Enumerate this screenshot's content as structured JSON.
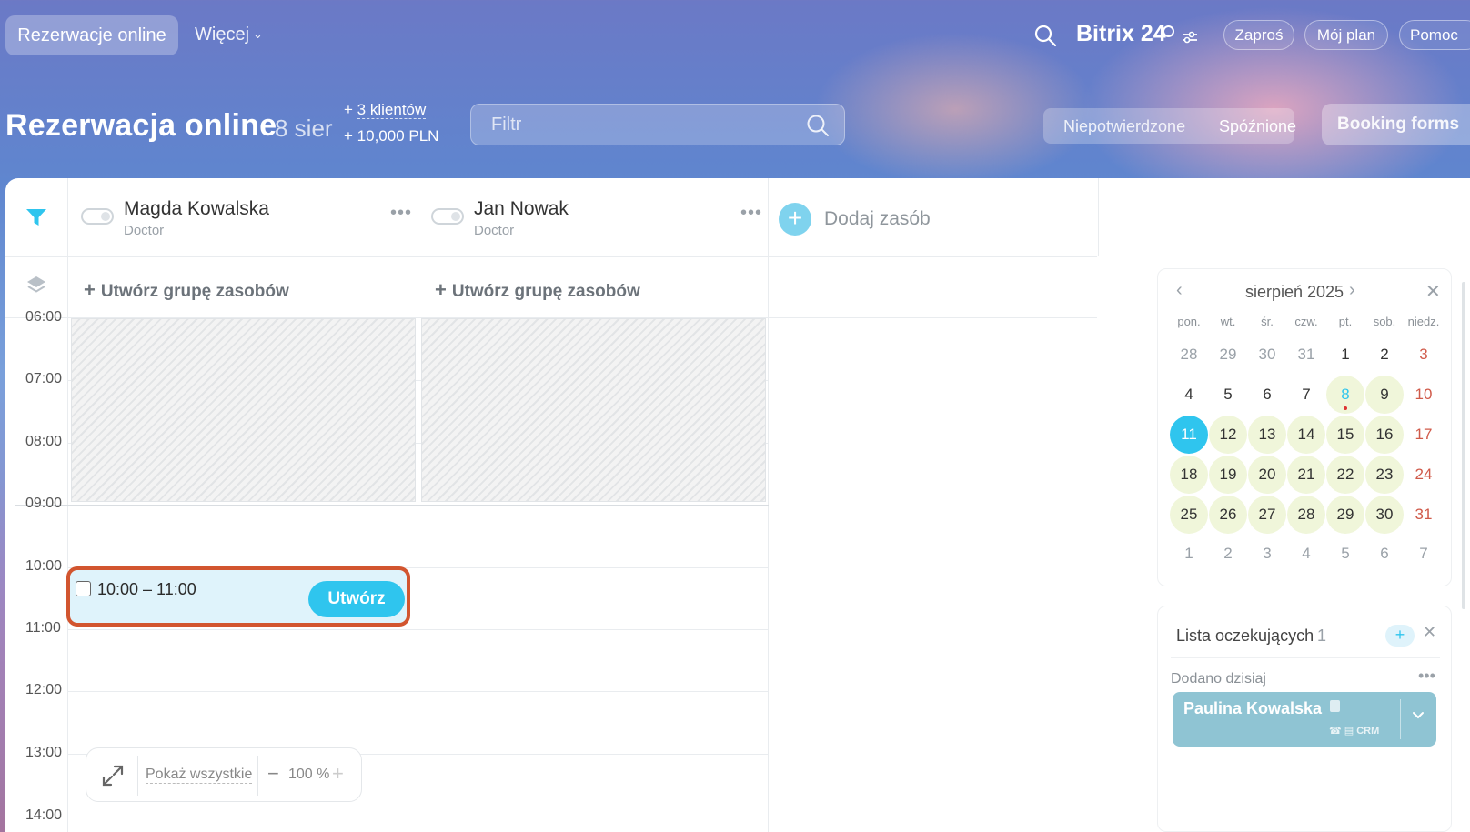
{
  "topbar": {
    "main_tab": "Rezerwacje online",
    "more": "Więcej",
    "logo": "Bitrix 24",
    "invite": "Zaproś",
    "my_plan": "Mój plan",
    "help": "Pomoc"
  },
  "header": {
    "title": "Rezerwacja online",
    "date": "8 sier",
    "stat_clients": "3 klientów",
    "stat_amount": "10,000 PLN",
    "stat_prefix": "+",
    "filter_placeholder": "Filtr",
    "unconfirmed": "Niepotwierdzone",
    "late": "Spóźnione",
    "booking_forms": "Booking forms"
  },
  "resources": [
    {
      "name": "Magda Kowalska",
      "role": "Doctor"
    },
    {
      "name": "Jan Nowak",
      "role": "Doctor"
    }
  ],
  "add_resource": "Dodaj zasób",
  "create_group": "Utwórz grupę zasobów",
  "timeline": {
    "hours": [
      "06:00",
      "07:00",
      "08:00",
      "09:00",
      "10:00",
      "11:00",
      "12:00",
      "13:00",
      "14:00"
    ]
  },
  "booking": {
    "time": "10:00 – 11:00",
    "create": "Utwórz"
  },
  "zoom": {
    "show_all": "Pokaż wszystkie",
    "minus": "−",
    "value": "100 %",
    "plus": "+"
  },
  "calendar": {
    "title": "sierpień 2025",
    "weekdays": [
      "pon.",
      "wt.",
      "śr.",
      "czw.",
      "pt.",
      "sob.",
      "niedz."
    ],
    "weeks": [
      [
        "28",
        "29",
        "30",
        "31",
        "1",
        "2",
        "3"
      ],
      [
        "4",
        "5",
        "6",
        "7",
        "8",
        "9",
        "10"
      ],
      [
        "11",
        "12",
        "13",
        "14",
        "15",
        "16",
        "17"
      ],
      [
        "18",
        "19",
        "20",
        "21",
        "22",
        "23",
        "24"
      ],
      [
        "25",
        "26",
        "27",
        "28",
        "29",
        "30",
        "31"
      ],
      [
        "1",
        "2",
        "3",
        "4",
        "5",
        "6",
        "7"
      ]
    ],
    "today": "8",
    "selected": "11"
  },
  "waiting_list": {
    "title": "Lista oczekujących",
    "count": "1",
    "add": "+",
    "added_today": "Dodano dzisiaj",
    "client_name": "Paulina Kowalska",
    "crm_tag": "CRM"
  },
  "colors": {
    "accent": "#2fc5ee",
    "booking_border": "#d2552f",
    "available_day": "#f0f6da",
    "sunday": "#d05a4a"
  }
}
